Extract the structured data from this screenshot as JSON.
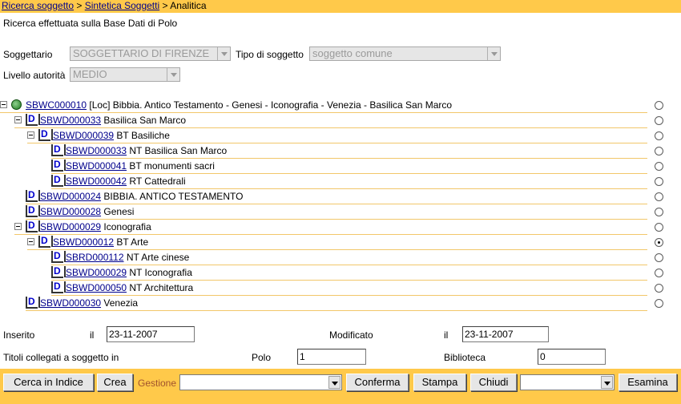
{
  "breadcrumb": {
    "items": [
      "Ricerca soggetto",
      "Sintetica Soggetti"
    ],
    "current": "Analitica",
    "separator": ">"
  },
  "info": "Ricerca effettuata sulla Base Dati di Polo",
  "filters": {
    "soggettario_label": "Soggettario",
    "soggettario_value": "SOGGETTARIO DI FIRENZE",
    "tipo_label": "Tipo di soggetto",
    "tipo_value": "soggetto comune",
    "livello_label": "Livello autorità",
    "livello_value": "MEDIO"
  },
  "tree": [
    {
      "code": "SBWC000010",
      "text": "[Loc] Bibbia. Antico Testamento - Genesi - Iconografia - Venezia - Basilica San Marco",
      "icon": "globe-icon",
      "level": 0,
      "toggle": true,
      "selected": false
    },
    {
      "code": "SBWD000033",
      "text": "Basilica San Marco",
      "icon": "descriptor-icon",
      "level": 1,
      "toggle": true,
      "selected": false
    },
    {
      "code": "SBWD000039",
      "text": "BT Basiliche",
      "icon": "descriptor-icon",
      "level": 2,
      "toggle": true,
      "selected": false
    },
    {
      "code": "SBWD000033",
      "text": "NT Basilica San Marco",
      "icon": "descriptor-icon",
      "level": 3,
      "toggle": false,
      "selected": false
    },
    {
      "code": "SBWD000041",
      "text": "BT monumenti sacri",
      "icon": "descriptor-icon",
      "level": 3,
      "toggle": false,
      "selected": false
    },
    {
      "code": "SBWD000042",
      "text": "RT Cattedrali",
      "icon": "descriptor-icon",
      "level": 3,
      "toggle": false,
      "selected": false
    },
    {
      "code": "SBWD000024",
      "text": "BIBBIA. ANTICO TESTAMENTO",
      "icon": "descriptor-icon",
      "level": 1,
      "toggle": false,
      "selected": false
    },
    {
      "code": "SBWD000028",
      "text": "Genesi",
      "icon": "descriptor-icon",
      "level": 1,
      "toggle": false,
      "selected": false
    },
    {
      "code": "SBWD000029",
      "text": "Iconografia",
      "icon": "descriptor-icon",
      "level": 1,
      "toggle": true,
      "selected": false
    },
    {
      "code": "SBWD000012",
      "text": "BT Arte",
      "icon": "descriptor-icon",
      "level": 2,
      "toggle": true,
      "selected": true
    },
    {
      "code": "SBRD000112",
      "text": "NT Arte cinese",
      "icon": "descriptor-icon",
      "level": 3,
      "toggle": false,
      "selected": false
    },
    {
      "code": "SBWD000029",
      "text": "NT Iconografia",
      "icon": "descriptor-icon",
      "level": 3,
      "toggle": false,
      "selected": false
    },
    {
      "code": "SBWD000050",
      "text": "NT Architettura",
      "icon": "descriptor-icon",
      "level": 3,
      "toggle": false,
      "selected": false
    },
    {
      "code": "SBWD000030",
      "text": "Venezia",
      "icon": "descriptor-icon",
      "level": 1,
      "toggle": false,
      "selected": false
    }
  ],
  "details": {
    "inserito_label": "Inserito",
    "il_label": "il",
    "inserito_value": "23-11-2007",
    "modificato_label": "Modificato",
    "modificato_value": "23-11-2007",
    "titoli_label": "Titoli collegati a soggetto in",
    "polo_label": "Polo",
    "polo_value": "1",
    "biblioteca_label": "Biblioteca",
    "biblioteca_value": "0"
  },
  "toolbar": {
    "cerca_label": "Cerca in Indice",
    "crea_label": "Crea",
    "gestione_label": "Gestione",
    "gestione_value": "",
    "conferma_label": "Conferma",
    "stampa_label": "Stampa",
    "chiudi_label": "Chiudi",
    "extra_value": "",
    "esamina_label": "Esamina"
  },
  "colors": {
    "accent": "#ffc94a",
    "link": "#00008b",
    "row_border": "#f2c76a"
  }
}
